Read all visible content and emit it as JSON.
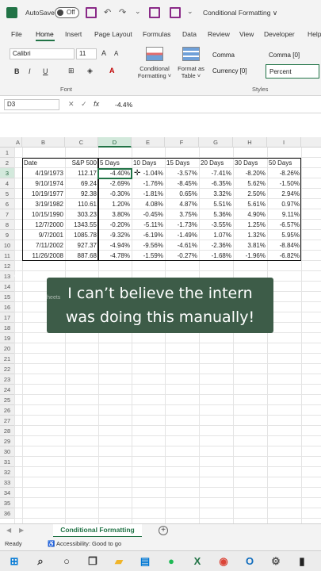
{
  "titlebar": {
    "autosave_label": "AutoSave",
    "autosave_state": "Off",
    "workbook_title": "Conditional Formatting ∨"
  },
  "ribbon_tabs": [
    "File",
    "Home",
    "Insert",
    "Page Layout",
    "Formulas",
    "Data",
    "Review",
    "View",
    "Developer",
    "Help"
  ],
  "active_tab": "Home",
  "ribbon": {
    "font_name": "Calibri",
    "font_size": "11",
    "bold": "B",
    "italic": "I",
    "underline": "U",
    "font_group_label": "Font",
    "cf_label_1": "Conditional",
    "cf_label_2": "Formatting ˅",
    "fat_label_1": "Format as",
    "fat_label_2": "Table ˅",
    "styles": [
      "Comma",
      "Comma [0]",
      "Currency [0]",
      "Percent"
    ],
    "styles_group_label": "Styles",
    "selected_style": "Percent"
  },
  "formula_bar": {
    "name_box": "D3",
    "fx": "fx",
    "content": "-4.4%"
  },
  "columns": [
    "A",
    "B",
    "C",
    "D",
    "E",
    "F",
    "G",
    "H",
    "I"
  ],
  "selected_column": "D",
  "rows": [
    "1",
    "2",
    "3",
    "4",
    "5",
    "6",
    "7",
    "8",
    "9",
    "10",
    "11",
    "12",
    "13",
    "14",
    "15",
    "16",
    "17",
    "18",
    "19",
    "20",
    "21",
    "22",
    "23",
    "24",
    "25",
    "26",
    "27",
    "28",
    "29",
    "30",
    "31",
    "32",
    "33",
    "34",
    "35",
    "36"
  ],
  "selected_row": "3",
  "table": {
    "headers": [
      "Date",
      "S&P 500",
      "5 Days",
      "10 Days",
      "15 Days",
      "20 Days",
      "30 Days",
      "50 Days"
    ],
    "rows": [
      [
        "4/19/1973",
        "112.17",
        "-4.40%",
        "-1.04%",
        "-3.57%",
        "-7.41%",
        "-8.20%",
        "-8.26%"
      ],
      [
        "9/10/1974",
        "69.24",
        "-2.69%",
        "-1.76%",
        "-8.45%",
        "-6.35%",
        "5.62%",
        "-1.50%"
      ],
      [
        "10/19/1977",
        "92.38",
        "-0.30%",
        "-1.81%",
        "0.65%",
        "3.32%",
        "2.50%",
        "2.94%"
      ],
      [
        "3/19/1982",
        "110.61",
        "1.20%",
        "4.08%",
        "4.87%",
        "5.51%",
        "5.61%",
        "0.97%"
      ],
      [
        "10/15/1990",
        "303.23",
        "3.80%",
        "-0.45%",
        "3.75%",
        "5.36%",
        "4.90%",
        "9.11%"
      ],
      [
        "12/7/2000",
        "1343.55",
        "-0.20%",
        "-5.11%",
        "-1.73%",
        "-3.55%",
        "1.25%",
        "-6.57%"
      ],
      [
        "9/7/2001",
        "1085.78",
        "-9.32%",
        "-6.19%",
        "-1.49%",
        "1.07%",
        "1.32%",
        "5.95%"
      ],
      [
        "7/11/2002",
        "927.37",
        "-4.94%",
        "-9.56%",
        "-4.61%",
        "-2.36%",
        "3.81%",
        "-8.84%"
      ],
      [
        "11/26/2008",
        "887.68",
        "-4.78%",
        "-1.59%",
        "-0.27%",
        "-1.68%",
        "-1.96%",
        "-6.82%"
      ]
    ]
  },
  "caption": {
    "line1": "I can’t believe the intern",
    "line2": "was doing this manually!"
  },
  "watermark": {
    "brand": "TikTok",
    "handle": "@cxlsheets"
  },
  "sheet_tab": "Conditional Formatting",
  "status": {
    "ready": "Ready",
    "accessibility": "Accessibility: Good to go"
  },
  "colors": {
    "accent": "#217346",
    "caption_bg": "#3d5c48"
  },
  "taskbar_icons": [
    "windows-icon",
    "search-icon",
    "cortana-icon",
    "task-view-icon",
    "file-explorer-icon",
    "store-icon",
    "spotify-icon",
    "excel-icon",
    "chrome-icon",
    "outlook-icon",
    "settings-icon",
    "terminal-icon"
  ]
}
